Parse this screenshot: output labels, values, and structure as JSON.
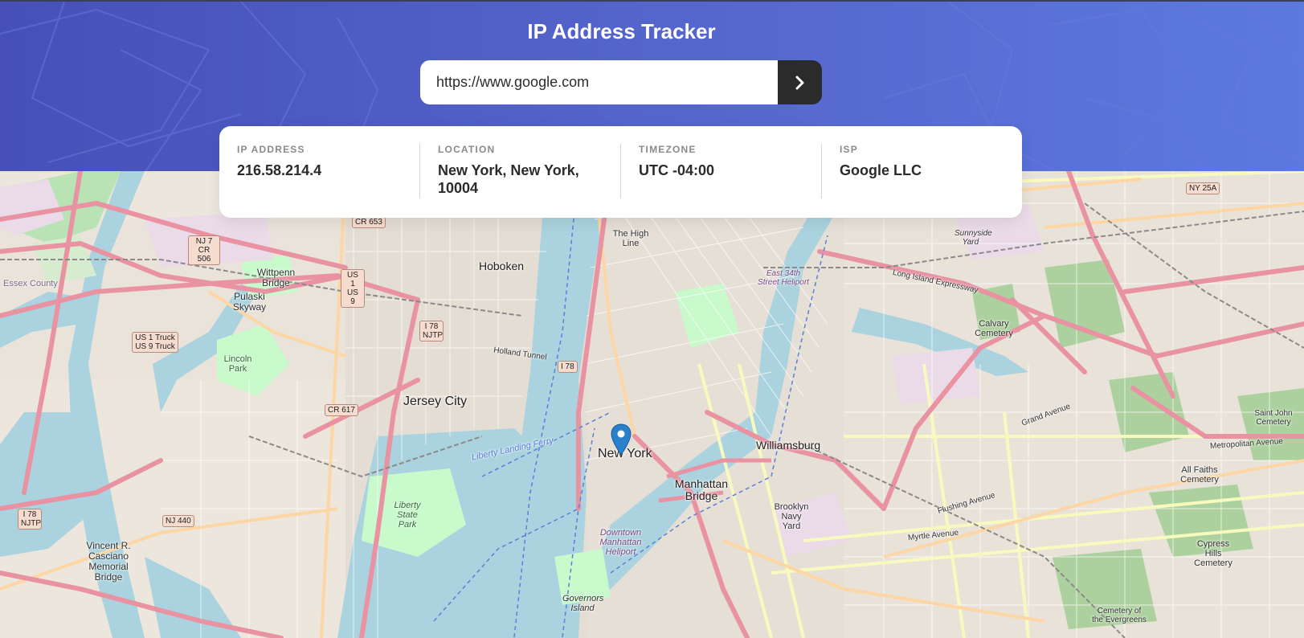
{
  "app": {
    "title": "IP Address Tracker"
  },
  "search": {
    "value": "https://www.google.com",
    "button_icon": "chevron-right-icon"
  },
  "info": {
    "ip_label": "IP Address",
    "ip_value": "216.58.214.4",
    "location_label": "Location",
    "location_value": "New York, New York, 10004",
    "timezone_label": "Timezone",
    "timezone_value": "UTC -04:00",
    "isp_label": "ISP",
    "isp_value": "Google LLC"
  },
  "map": {
    "marker_icon": "map-pin-icon",
    "labels": {
      "new_york": "New York",
      "jersey_city": "Jersey City",
      "hoboken": "Hoboken",
      "williamsburg": "Williamsburg",
      "manhattan_bridge": "Manhattan Bridge",
      "the_high_line": "The High Line",
      "wittpenn_bridge": "Wittpenn Bridge",
      "pulaski_skyway": "Pulaski Skyway",
      "lincoln_park": "Lincoln Park",
      "liberty_state_park": "Liberty State Park",
      "calvary_cemetery": "Calvary Cemetery",
      "all_faiths_cemetery": "All Faiths Cemetery",
      "cypress_hills_cemetery": "Cypress Hills Cemetery",
      "brooklyn_navy_yard": "Brooklyn Navy Yard",
      "governors_island": "Governors Island",
      "downtown_heliport": "Downtown Manhattan Heliport",
      "vincent_bridge": "Vincent R. Casciano Memorial Bridge",
      "essex_county": "Essex County",
      "long_island_expressway": "Long Island Expressway",
      "holland_tunnel": "Holland Tunnel",
      "liberty_landing_ferry": "Liberty Landing Ferry",
      "metropolitan_avenue": "Metropolitan Avenue",
      "flushing_avenue": "Flushing Avenue",
      "myrtle_avenue": "Myrtle Avenue",
      "grand_avenue": "Grand Avenue",
      "sunnyside_yard": "Sunnyside Yard",
      "east_34th_heliport": "East 34th Street Heliport",
      "saint_john_cemetery": "Saint John Cemetery",
      "cemetery_evergreens": "Cemetery of the Evergreens"
    },
    "shields": {
      "nj7": "NJ 7 CR 506",
      "us1": "US 1 US 9",
      "i78_njtp": "I 78 NJTP",
      "us1truck": "US 1 Truck US 9 Truck",
      "cr617": "CR 617",
      "cr653": "CR 653",
      "i78": "I 78",
      "nj440": "NJ 440",
      "ny25a": "NY 25A",
      "i78_njtp_2": "I 78 NJTP"
    }
  },
  "colors": {
    "header_start": "#4650b8",
    "header_end": "#5c79e0",
    "dark_button": "#2b2b2b",
    "water": "#aad3df",
    "park": "#c8facc",
    "major_road": "#e892a2",
    "secondary_road": "#fcd6a4"
  }
}
